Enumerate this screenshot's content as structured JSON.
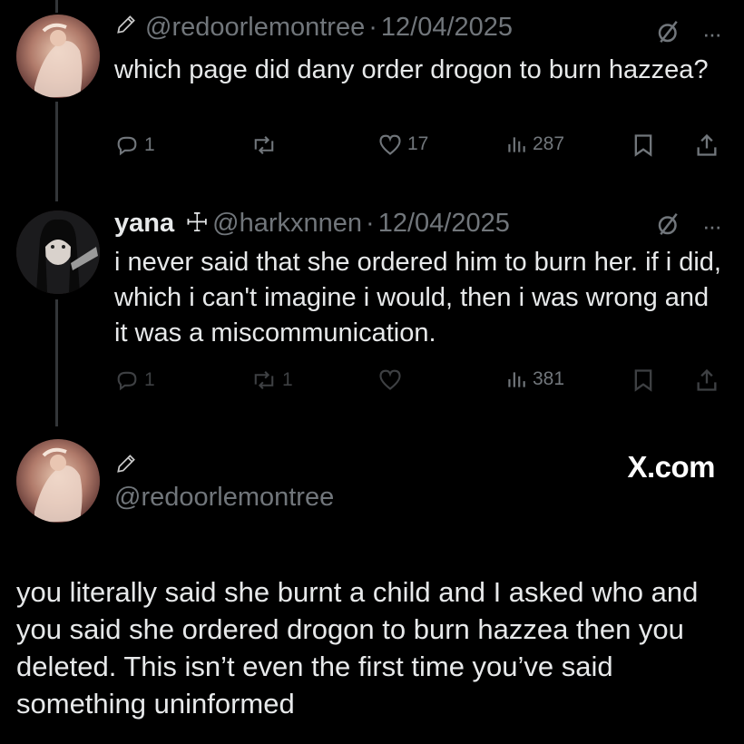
{
  "tweet1": {
    "handle": "@redoorlemontree",
    "date": "12/04/2025",
    "text": "which page did dany order drogon to burn hazzea?",
    "replies": "1",
    "likes": "17",
    "views": "287"
  },
  "tweet2": {
    "name": "yana",
    "name_symbol": "☩",
    "handle": "@harkxnnen",
    "date": "12/04/2025",
    "text": "i never said that she ordered him to burn her. if i did, which i can't imagine i would, then i was wrong and it was a miscommunication.",
    "replies": "1",
    "reposts": "1",
    "views": "381"
  },
  "reply": {
    "handle": "@redoorlemontree",
    "brand": "X.com",
    "text": "you literally said she burnt a child and I asked who and you said she ordered drogon to burn hazzea then you deleted.  This isn’t even the first time you’ve said something uninformed"
  },
  "icons": [
    "pencil-icon",
    "grok-slash-icon",
    "more-icon",
    "reply-icon",
    "repost-icon",
    "like-icon",
    "views-icon",
    "bookmark-icon",
    "share-icon"
  ]
}
